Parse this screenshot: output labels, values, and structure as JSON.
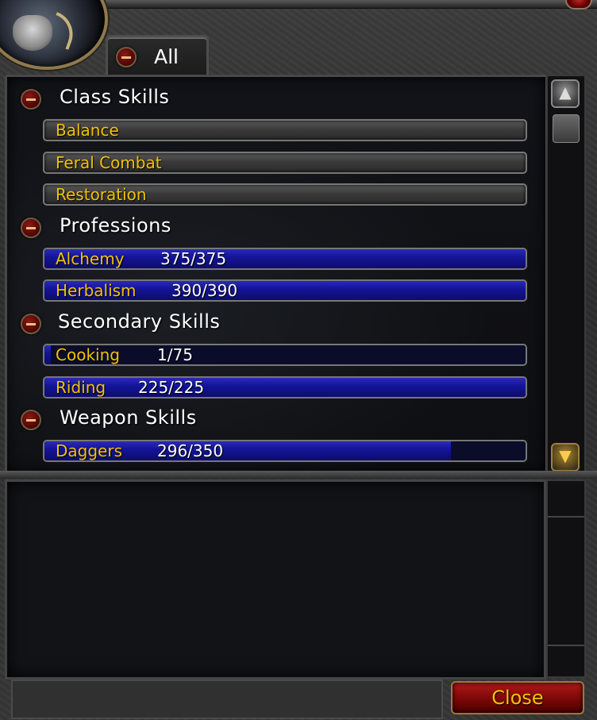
{
  "tab": {
    "label": "All"
  },
  "categories": [
    {
      "name": "Class Skills",
      "skills": [
        {
          "name": "Balance",
          "value": "",
          "fraction": null
        },
        {
          "name": "Feral Combat",
          "value": "",
          "fraction": null
        },
        {
          "name": "Restoration",
          "value": "",
          "fraction": null
        }
      ]
    },
    {
      "name": "Professions",
      "skills": [
        {
          "name": "Alchemy",
          "value": "375/375",
          "fraction": 1.0
        },
        {
          "name": "Herbalism",
          "value": "390/390",
          "fraction": 1.0
        }
      ]
    },
    {
      "name": "Secondary Skills",
      "skills": [
        {
          "name": "Cooking",
          "value": "1/75",
          "fraction": 0.0133
        },
        {
          "name": "Riding",
          "value": "225/225",
          "fraction": 1.0
        }
      ]
    },
    {
      "name": "Weapon Skills",
      "skills": [
        {
          "name": "Daggers",
          "value": "296/350",
          "fraction": 0.8457
        }
      ]
    }
  ],
  "scroll": {
    "up_icon": "scroll-up-icon",
    "down_icon": "scroll-down-icon"
  },
  "buttons": {
    "close": "Close"
  }
}
